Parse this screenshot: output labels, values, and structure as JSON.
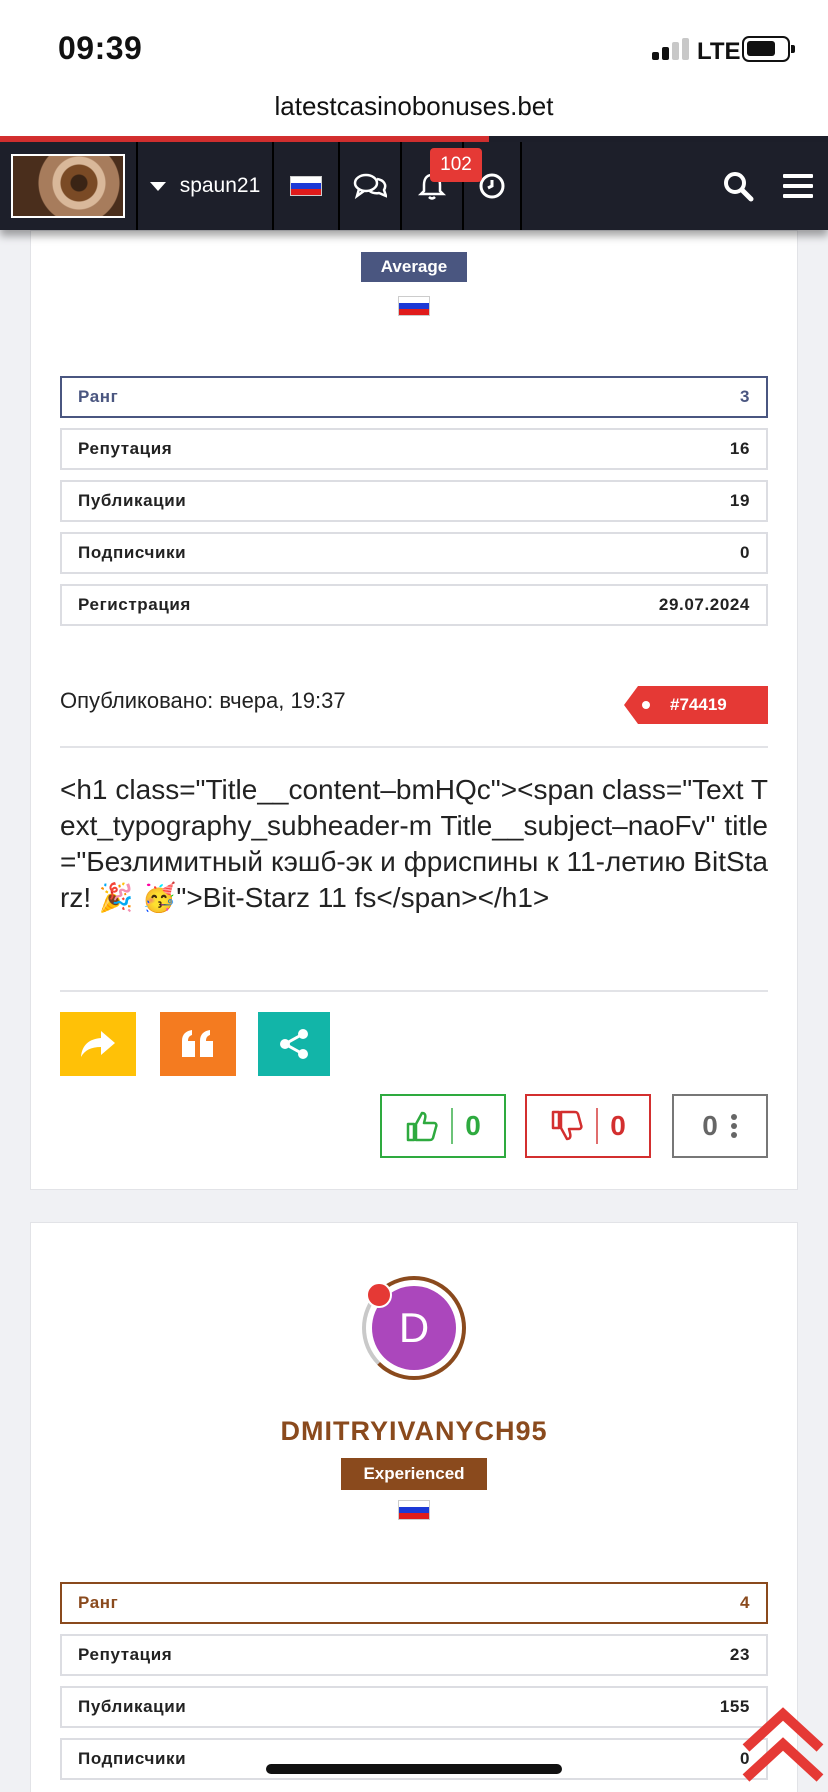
{
  "status": {
    "time": "09:39",
    "network": "LTE"
  },
  "browser": {
    "url": "latestcasinobonuses.bet",
    "load_progress": 0.59
  },
  "navbar": {
    "username": "spaun21",
    "notification_count": "102"
  },
  "profile1": {
    "rank_title": "Average",
    "stats": [
      {
        "label": "Ранг",
        "value": "3"
      },
      {
        "label": "Репутация",
        "value": "16"
      },
      {
        "label": "Публикации",
        "value": "19"
      },
      {
        "label": "Подписчики",
        "value": "0"
      },
      {
        "label": "Регистрация",
        "value": "29.07.2024"
      }
    ]
  },
  "post": {
    "published": "Опубликовано: вчера, 19:37",
    "post_id": "#74419",
    "body": "<h1 class=\"Title__content–bmHQc\"><span class=\"Text Text_typography_subheader-m Title__subject–naoFv\" title=\"Безлимитный кэшб-эк и фриспины к 11-летию BitStarz! 🎉 🥳\">Bit-Starz 11 fs</span></h1>",
    "likes": "0",
    "dislikes": "0",
    "score": "0"
  },
  "profile2": {
    "avatar_letter": "D",
    "username": "DMITRYIVANYCH95",
    "rank_title": "Experienced",
    "stats": [
      {
        "label": "Ранг",
        "value": "4"
      },
      {
        "label": "Репутация",
        "value": "23"
      },
      {
        "label": "Публикации",
        "value": "155"
      },
      {
        "label": "Подписчики",
        "value": "0"
      }
    ]
  },
  "colors": {
    "nav_bg": "#1d1f2a",
    "accent_red": "#e53935",
    "rank_blue": "#4a5680",
    "rank_brown": "#8a4a1d",
    "reply": "#ffc107",
    "quote": "#f47b20",
    "share": "#12b5a8",
    "like": "#2eaa3f"
  },
  "icons": [
    "caret-down-icon",
    "russia-flag-icon",
    "chat-bubbles-icon",
    "bell-icon",
    "clock-icon",
    "search-icon",
    "menu-icon",
    "reply-icon",
    "quote-icon",
    "share-icon",
    "thumbs-up-icon",
    "thumbs-down-icon",
    "more-vertical-icon",
    "scroll-top-icon"
  ]
}
